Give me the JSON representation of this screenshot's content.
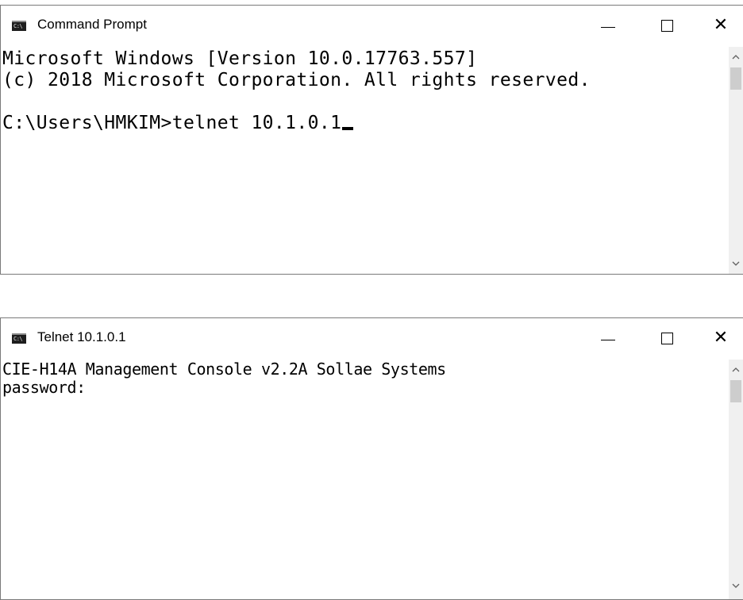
{
  "windows": [
    {
      "title": "Command Prompt",
      "icon": "cmd-app-icon",
      "icon_text": "C:\\",
      "lines": [
        "Microsoft Windows [Version 10.0.17763.557]",
        "(c) 2018 Microsoft Corporation. All rights reserved.",
        "",
        "C:\\Users\\HMKIM>telnet 10.1.0.1"
      ]
    },
    {
      "title": "Telnet 10.1.0.1",
      "icon": "telnet-app-icon",
      "icon_text": "C:\\",
      "lines": [
        "CIE-H14A Management Console v2.2A Sollae Systems",
        "password:"
      ]
    }
  ],
  "controls": {
    "minimize_icon": "minimize-icon",
    "maximize_icon": "maximize-icon",
    "close_icon": "close-icon",
    "close_glyph": "✕"
  },
  "colors": {
    "console_background": "#ffffff",
    "console_text": "#000000",
    "scrollbar_track": "#f0f0f0",
    "scrollbar_thumb": "#cdcdcd"
  }
}
